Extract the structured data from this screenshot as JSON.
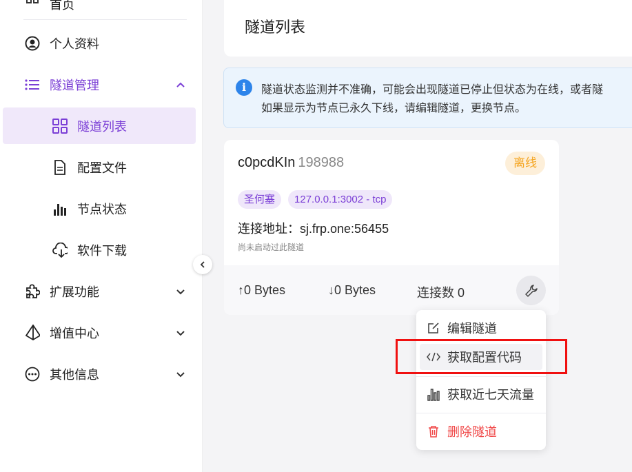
{
  "sidebar": {
    "items": [
      {
        "label": "首页",
        "icon": "home-icon"
      },
      {
        "label": "个人资料",
        "icon": "user-circle-icon"
      },
      {
        "label": "隧道管理",
        "icon": "list-icon",
        "expanded": true
      },
      {
        "label": "隧道列表",
        "icon": "grid-icon",
        "active": true
      },
      {
        "label": "配置文件",
        "icon": "file-icon"
      },
      {
        "label": "节点状态",
        "icon": "bar-chart-icon"
      },
      {
        "label": "软件下载",
        "icon": "cloud-download-icon"
      },
      {
        "label": "扩展功能",
        "icon": "puzzle-icon"
      },
      {
        "label": "增值中心",
        "icon": "diamond-icon"
      },
      {
        "label": "其他信息",
        "icon": "more-icon"
      }
    ]
  },
  "header": {
    "title": "隧道列表"
  },
  "alert": {
    "line1": "隧道状态监测并不准确，可能会出现隧道已停止但状态为在线，或者隧",
    "line2": "如果显示为节点已永久下线，请编辑隧道，更换节点。"
  },
  "tunnel": {
    "name": "c0pcdKIn",
    "id": "198988",
    "status": "离线",
    "node": "圣何塞",
    "local": "127.0.0.1:3002 - tcp",
    "address": "连接地址：sj.frp.one:56455",
    "hint": "尚未启动过此隧道",
    "upload": "↑0 Bytes",
    "download": "↓0 Bytes",
    "connections": "连接数 0"
  },
  "menu": {
    "items": [
      "编辑隧道",
      "获取配置代码",
      "获取近七天流量",
      "删除隧道"
    ]
  },
  "colors": {
    "accent": "#7b3fd6",
    "offline": "#f5a623",
    "danger": "#f04848",
    "highlight": "#f01010"
  }
}
